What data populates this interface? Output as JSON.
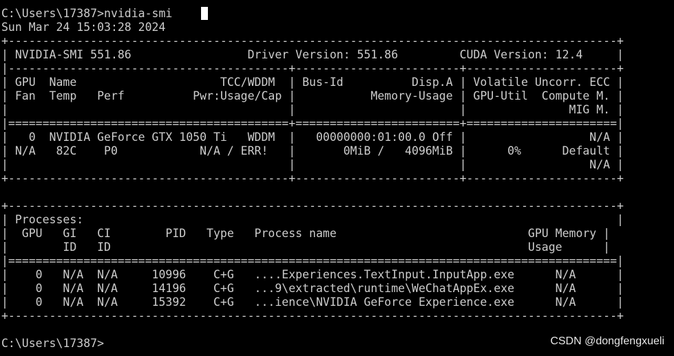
{
  "colors": {
    "background": "#000000",
    "text": "#cccccc",
    "cursor": "#ffffff"
  },
  "terminal": {
    "lines": [
      "C:\\Users\\17387>nvidia-smi",
      "Sun Mar 24 15:03:28 2024",
      "+-----------------------------------------------------------------------------------------+",
      "| NVIDIA-SMI 551.86                 Driver Version: 551.86         CUDA Version: 12.4     |",
      "|-----------------------------------------+------------------------+----------------------+",
      "| GPU  Name                     TCC/WDDM  | Bus-Id          Disp.A | Volatile Uncorr. ECC |",
      "| Fan  Temp   Perf          Pwr:Usage/Cap |           Memory-Usage | GPU-Util  Compute M. |",
      "|                                         |                        |               MIG M. |",
      "|=========================================+========================+======================|",
      "|   0  NVIDIA GeForce GTX 1050 Ti   WDDM  |   00000000:01:00.0 Off |                  N/A |",
      "| N/A   82C    P0            N/A / ERR!   |       0MiB /   4096MiB |      0%      Default |",
      "|                                         |                        |                  N/A |",
      "+-----------------------------------------+------------------------+----------------------+",
      "",
      "+-----------------------------------------------------------------------------------------+",
      "| Processes:                                                                              |",
      "|  GPU   GI   CI        PID   Type   Process name                            GPU Memory |",
      "|        ID   ID                                                             Usage      |",
      "|=========================================================================================|",
      "|    0   N/A  N/A     10996    C+G   ....Experiences.TextInput.InputApp.exe      N/A      |",
      "|    0   N/A  N/A     14196    C+G   ...9\\extracted\\runtime\\WeChatAppEx.exe      N/A      |",
      "|    0   N/A  N/A     15392    C+G   ...ience\\NVIDIA GeForce Experience.exe      N/A      |",
      "+-----------------------------------------------------------------------------------------+",
      "",
      "C:\\Users\\17387>"
    ]
  },
  "watermark": "CSDN @dongfengxueli"
}
